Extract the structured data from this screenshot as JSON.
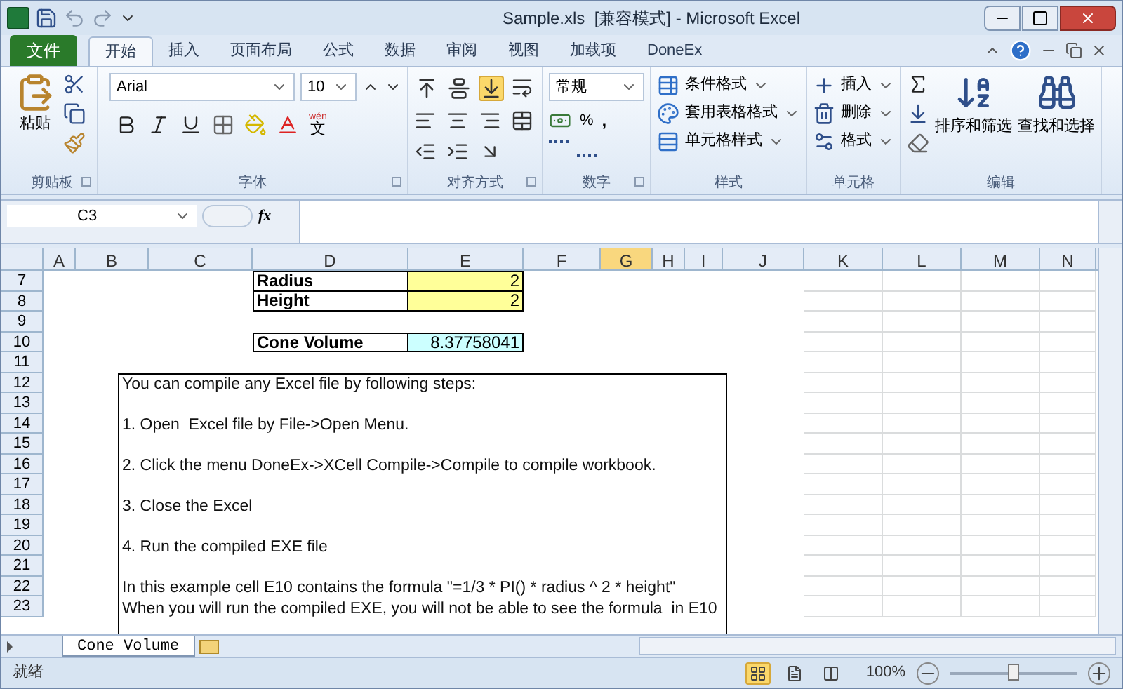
{
  "window": {
    "title": "Sample.xls  [兼容模式] - Microsoft Excel"
  },
  "tabs": [
    {
      "label": "文件",
      "kind": "file",
      "selected": false
    },
    {
      "label": "开始",
      "kind": "tab",
      "selected": true
    },
    {
      "label": "插入",
      "kind": "tab",
      "selected": false
    },
    {
      "label": "页面布局",
      "kind": "tab",
      "selected": false
    },
    {
      "label": "公式",
      "kind": "tab",
      "selected": false
    },
    {
      "label": "数据",
      "kind": "tab",
      "selected": false
    },
    {
      "label": "审阅",
      "kind": "tab",
      "selected": false
    },
    {
      "label": "视图",
      "kind": "tab",
      "selected": false
    },
    {
      "label": "加载项",
      "kind": "tab",
      "selected": false
    },
    {
      "label": "DoneEx",
      "kind": "tab",
      "selected": false
    }
  ],
  "ribbon": {
    "clipboard": {
      "label": "剪贴板",
      "paste": "粘贴"
    },
    "font": {
      "label": "字体",
      "font_name": "Arial",
      "font_size": "10",
      "phonetic_top": "wén",
      "phonetic_glyph": "文"
    },
    "alignment": {
      "label": "对齐方式",
      "vertical": [
        {
          "kind": "top",
          "selected": false
        },
        {
          "kind": "middle",
          "selected": false
        },
        {
          "kind": "bottom",
          "selected": true
        }
      ]
    },
    "number": {
      "label": "数字",
      "format": "常规",
      "percent": "%",
      "comma": ","
    },
    "styles": {
      "label": "样式",
      "items": [
        "条件格式",
        "套用表格格式",
        "单元格样式"
      ]
    },
    "cells": {
      "label": "单元格",
      "items": [
        "插入",
        "删除",
        "格式"
      ]
    },
    "editing": {
      "label": "编辑",
      "sort": "排序和筛选",
      "find": "查找和选择"
    }
  },
  "formula_bar": {
    "name_box": "C3",
    "function_label": "fx"
  },
  "columns": [
    {
      "label": "A",
      "selected": false
    },
    {
      "label": "B",
      "selected": false
    },
    {
      "label": "C",
      "selected": false
    },
    {
      "label": "D",
      "selected": false
    },
    {
      "label": "E",
      "selected": false
    },
    {
      "label": "F",
      "selected": false
    },
    {
      "label": "G",
      "selected": true
    },
    {
      "label": "H",
      "selected": false
    },
    {
      "label": "I",
      "selected": false
    },
    {
      "label": "J",
      "selected": false
    },
    {
      "label": "K",
      "selected": false
    },
    {
      "label": "L",
      "selected": false
    },
    {
      "label": "M",
      "selected": false
    },
    {
      "label": "N",
      "selected": false
    }
  ],
  "rows": [
    {
      "label": "7",
      "cell": {
        "label": "Radius",
        "value": "2",
        "kind": "input"
      }
    },
    {
      "label": "8",
      "cell": {
        "label": "Height",
        "value": "2",
        "kind": "input"
      }
    },
    {
      "label": "9"
    },
    {
      "label": "10",
      "cell": {
        "label": "Cone Volume",
        "value": "8.37758041",
        "kind": "output"
      }
    },
    {
      "label": "11"
    },
    {
      "label": "12"
    },
    {
      "label": "13"
    },
    {
      "label": "14"
    },
    {
      "label": "15"
    },
    {
      "label": "16"
    },
    {
      "label": "17"
    },
    {
      "label": "18"
    },
    {
      "label": "19"
    },
    {
      "label": "20"
    },
    {
      "label": "21"
    },
    {
      "label": "22"
    },
    {
      "label": "23"
    }
  ],
  "text_box": {
    "paragraphs": [
      [
        "You can compile any Excel file by following steps:"
      ],
      [
        "1. Open  Excel file by File->Open Menu."
      ],
      [
        "2. Click the menu DoneEx->XCell Compile->Compile to compile workbook."
      ],
      [
        "3. Close the Excel"
      ],
      [
        "4. Run the compiled EXE file"
      ],
      [
        "In this example cell E10 contains the formula \"=1/3 * PI() * radius ^ 2 * height\"",
        "When you will run the compiled EXE, you will not be able to see the formula  in E10"
      ]
    ]
  },
  "sheet_tabs": [
    {
      "label": "Cone Volume",
      "selected": true
    }
  ],
  "status_bar": {
    "status": "就绪",
    "views": [
      {
        "kind": "normal",
        "selected": true
      },
      {
        "kind": "layout",
        "selected": false
      },
      {
        "kind": "pagebreak",
        "selected": false
      }
    ],
    "zoom": "100%",
    "zoom_slider": {
      "level": 0.5
    }
  }
}
